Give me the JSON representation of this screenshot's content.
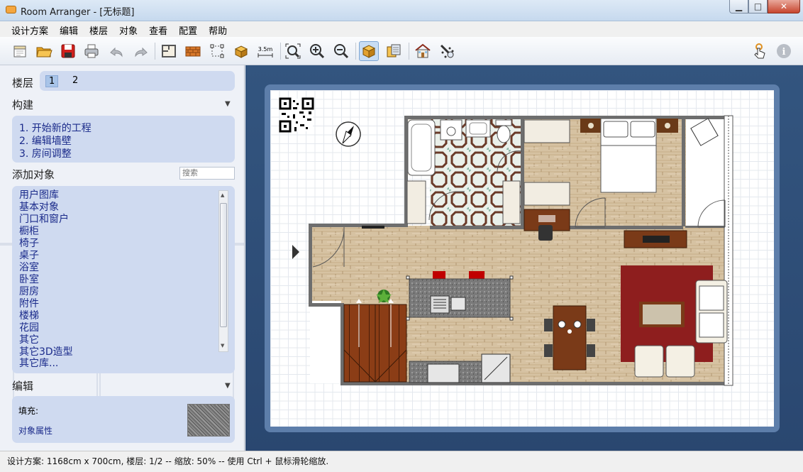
{
  "window": {
    "title": "Room Arranger - [无标题]",
    "minimize": "▁",
    "maximize": "□",
    "close": "✕"
  },
  "menu": [
    "设计方案",
    "编辑",
    "楼层",
    "对象",
    "查看",
    "配置",
    "帮助"
  ],
  "toolbar": {
    "buttons": [
      "new-icon",
      "open-icon",
      "save-icon",
      "print-icon",
      "undo-icon",
      "redo-icon",
      "room-icon",
      "wall-icon",
      "polyline-icon",
      "object-icon",
      "measure-icon",
      "zoom-fit-icon",
      "zoom-in-icon",
      "zoom-out-icon",
      "view-2d-icon",
      "view-layers-icon",
      "view-3d-icon",
      "effects-icon",
      "help-touch-icon",
      "info-icon"
    ],
    "measure_label": "3.5m"
  },
  "left": {
    "floor_label": "楼层",
    "floors": [
      "1",
      "2"
    ],
    "build_label": "构建",
    "steps": [
      "1.  开始新的工程",
      "2.  编辑墙壁",
      "3.  房间调整"
    ],
    "add_label": "添加对象",
    "search_placeholder": "搜索",
    "categories": [
      "用户图库",
      "基本对象",
      "门口和窗户",
      "橱柜",
      "椅子",
      "桌子",
      "浴室",
      "卧室",
      "厨房",
      "附件",
      "楼梯",
      "花园",
      "其它",
      "其它3D造型"
    ],
    "more": "其它库...",
    "edit_label": "编辑",
    "fill_label": "填充:",
    "props_label": "对象属性",
    "collapse_glyph": "▼"
  },
  "status": "设计方案: 1168cm x 700cm, 楼层: 1/2 -- 缩放: 50% -- 使用 Ctrl + 鼠标滑轮缩放."
}
